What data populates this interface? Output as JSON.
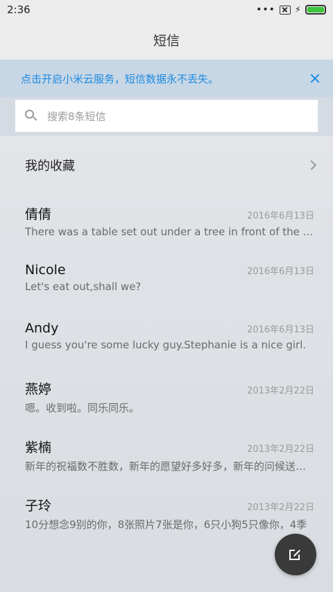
{
  "status_bar": {
    "time": "2:36",
    "dots": "•••"
  },
  "header": {
    "title": "短信"
  },
  "banner": {
    "text": "点击开启小米云服务，短信数据永不丢失。"
  },
  "search": {
    "placeholder": "搜索8条短信"
  },
  "favorites": {
    "label": "我的收藏"
  },
  "conversations": [
    {
      "name": "倩倩",
      "date": "2016年6月13日",
      "preview": "There was a table set out under a tree in front of the house"
    },
    {
      "name": "Nicole",
      "date": "2016年6月13日",
      "preview": "Let's eat out,shall we?"
    },
    {
      "name": "Andy",
      "date": "2016年6月13日",
      "preview": "I guess you're some lucky guy.Stephanie is a nice girl."
    },
    {
      "name": "燕婷",
      "date": "2013年2月22日",
      "preview": "嗯。收到啦。同乐同乐。"
    },
    {
      "name": "紫楠",
      "date": "2013年2月22日",
      "preview": "新年的祝福数不胜数，新年的愿望好多好多，新年的问候送给你"
    },
    {
      "name": "子玲",
      "date": "2013年2月22日",
      "preview": "10分想念9别的你，8张照片7张是你，6只小狗5只像你，4季"
    }
  ],
  "colors": {
    "accent_blue": "#1e8be0",
    "banner_bg": "#c7d7e6",
    "battery_green": "#3cc43c",
    "fab_bg": "#3a3a3a"
  },
  "icons": {
    "search": "search-icon",
    "close": "close-icon",
    "chevron": "chevron-right-icon",
    "compose": "compose-icon"
  }
}
